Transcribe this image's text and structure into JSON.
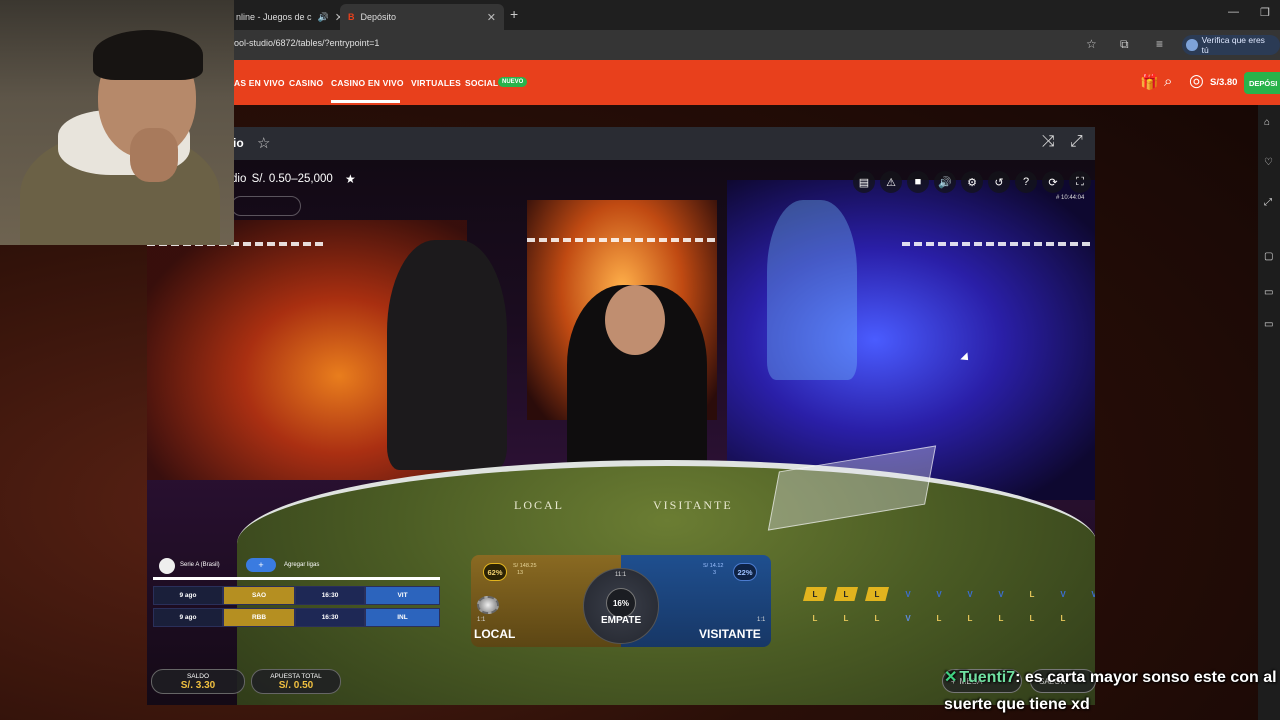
{
  "browser": {
    "tabs": [
      {
        "title": "nline - Juegos de c",
        "close": "✕"
      },
      {
        "title": "Depósito",
        "close": "✕"
      }
    ],
    "new_tab": "+",
    "url": "ool-studio/6872/tables/?entrypoint=1",
    "verify_label": "Verifica que eres tú"
  },
  "site_nav": {
    "items": [
      "AS EN VIVO",
      "CASINO",
      "CASINO EN VIVO",
      "VIRTUALES",
      "SOCIAL"
    ],
    "active_item": "CASINO EN VIVO",
    "new_badge": "NUEVO",
    "balance": "S/3.80",
    "deposit_label": "DEPÓSI"
  },
  "game": {
    "title_fragment": "io",
    "limit_prefix": "dio",
    "limit_range": "S/. 0.50–25,000",
    "stream_time": "# 10:44:04",
    "felt_local": "LOCAL",
    "felt_visitante": "VISITANTE",
    "bet_local": {
      "label": "LOCAL",
      "pct": "62%",
      "mini1": "S/ 148.25",
      "mini2": "13",
      "odds": "1:1"
    },
    "bet_visitante": {
      "label": "VISITANTE",
      "pct": "22%",
      "mini1": "S/ 14.12",
      "mini2": "3",
      "odds": "1:1"
    },
    "bet_tie": {
      "label": "EMPATE",
      "pct": "16%",
      "odds": "11:1"
    },
    "road_row1": [
      "L",
      "L",
      "L",
      "V",
      "V",
      "V",
      "V",
      "L",
      "V",
      "V"
    ],
    "road_row2": [
      "L",
      "L",
      "L",
      "V",
      "L",
      "L",
      "L",
      "L",
      "L"
    ],
    "league": {
      "name": "Serie A (Brasil)",
      "add_label": "Agregar ligas",
      "fixtures": [
        {
          "date": "9 ago",
          "home": "SAO",
          "time": "16:30",
          "away": "VIT"
        },
        {
          "date": "9 ago",
          "home": "RBB",
          "time": "16:30",
          "away": "INL"
        }
      ]
    },
    "saldo_label": "SALDO",
    "saldo_value": "S/. 3.30",
    "apuesta_label": "APUESTA TOTAL",
    "apuesta_value": "S/. 0.50",
    "mesa_label": "MESA",
    "salon_label": "SALÓN"
  },
  "chat": {
    "user": "Tuenti7",
    "message": " es carta mayor sonso este con al suerte que tiene xd"
  },
  "colors": {
    "nav_orange": "#e8401c",
    "deposit_green": "#28b34b",
    "local_gold": "#b58f21",
    "visitante_blue": "#2c64bd"
  }
}
